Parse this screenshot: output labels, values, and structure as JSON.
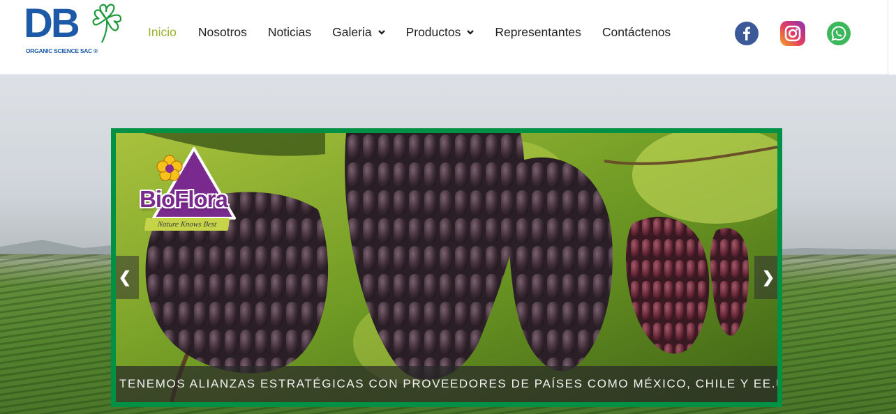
{
  "brand": {
    "logo_text": "DB",
    "logo_subtitle": "ORGANIC SCIENCE SAC ®"
  },
  "nav": {
    "items": [
      {
        "label": "Inicio",
        "active": true,
        "dropdown": false
      },
      {
        "label": "Nosotros",
        "active": false,
        "dropdown": false
      },
      {
        "label": "Noticias",
        "active": false,
        "dropdown": false
      },
      {
        "label": "Galeria",
        "active": false,
        "dropdown": true
      },
      {
        "label": "Productos",
        "active": false,
        "dropdown": true
      },
      {
        "label": "Representantes",
        "active": false,
        "dropdown": false
      },
      {
        "label": "Contáctenos",
        "active": false,
        "dropdown": false
      }
    ],
    "active_color": "#9bb32e"
  },
  "social": {
    "icons": [
      "facebook-icon",
      "instagram-icon",
      "whatsapp-icon"
    ],
    "colors": {
      "facebook": "#3b5998",
      "whatsapp": "#3db75b"
    }
  },
  "slider": {
    "frame_color": "#009145",
    "slide_brand": {
      "name": "BioFlora",
      "tagline": "Nature Knows Best"
    },
    "caption": "TENEMOS ALIANZAS ESTRATÉGICAS CON PROVEEDORES DE PAÍSES COMO MÉXICO, CHILE Y EE.UU.",
    "prev_label": "❮",
    "next_label": "❯"
  }
}
